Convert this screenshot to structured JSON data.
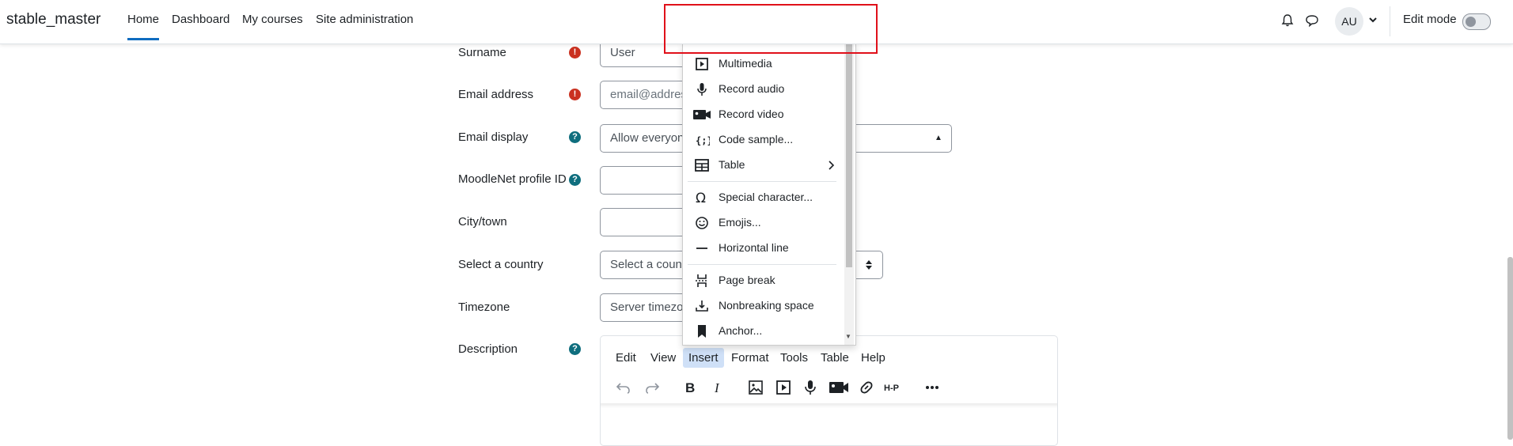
{
  "nav": {
    "brand": "stable_master",
    "items": [
      {
        "label": "Home",
        "active": true
      },
      {
        "label": "Dashboard"
      },
      {
        "label": "My courses"
      },
      {
        "label": "Site administration"
      }
    ],
    "avatar_initials": "AU",
    "edit_mode_label": "Edit mode",
    "accent_color": "#0f6cbf"
  },
  "form": {
    "surname": {
      "label": "Surname",
      "value": "User"
    },
    "email": {
      "label": "Email address",
      "placeholder": "email@address"
    },
    "email_display": {
      "label": "Email display",
      "value": "Allow everyon"
    },
    "moodlenet": {
      "label": "MoodleNet profile ID"
    },
    "city": {
      "label": "City/town"
    },
    "country": {
      "label": "Select a country",
      "value": "Select a coun"
    },
    "timezone": {
      "label": "Timezone",
      "value": "Server timezo"
    },
    "description": {
      "label": "Description"
    }
  },
  "editor": {
    "menus": [
      {
        "label": "Edit"
      },
      {
        "label": "View"
      },
      {
        "label": "Insert",
        "active": true
      },
      {
        "label": "Format"
      },
      {
        "label": "Tools"
      },
      {
        "label": "Table"
      },
      {
        "label": "Help"
      }
    ],
    "toolbar_icons": [
      "undo-icon",
      "redo-icon",
      "bold-icon",
      "italic-icon",
      "image-icon",
      "media-icon",
      "microphone-icon",
      "video-camera-icon",
      "link-icon",
      "h5p-icon",
      "more-icon"
    ],
    "h5p_text": "H-P"
  },
  "insert_menu": {
    "items": [
      {
        "label": "Multimedia",
        "icon": "multimedia-icon"
      },
      {
        "label": "Record audio",
        "icon": "microphone-icon"
      },
      {
        "label": "Record video",
        "icon": "video-camera-icon"
      },
      {
        "label": "Code sample...",
        "icon": "code-sample-icon"
      },
      {
        "label": "Table",
        "icon": "table-icon",
        "submenu": true
      },
      {
        "label": "Special character...",
        "icon": "omega-icon"
      },
      {
        "label": "Emojis...",
        "icon": "emoji-icon"
      },
      {
        "label": "Horizontal line",
        "icon": "horizontal-line-icon"
      },
      {
        "label": "Page break",
        "icon": "page-break-icon"
      },
      {
        "label": "Nonbreaking space",
        "icon": "nonbreaking-space-icon"
      },
      {
        "label": "Anchor...",
        "icon": "anchor-bookmark-icon"
      }
    ]
  },
  "colors": {
    "required": "#ca3120",
    "help": "#0f6e7e",
    "highlight": "#e0101a"
  }
}
